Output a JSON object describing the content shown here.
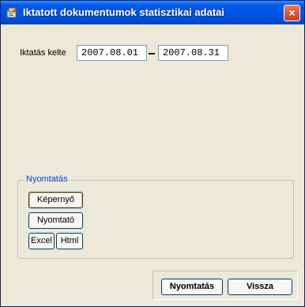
{
  "window": {
    "title": "Iktatott dokumentumok statisztikai adatai",
    "close_symbol": "×"
  },
  "date_filter": {
    "label": "Iktatás kelte",
    "from": "2007.08.01",
    "to": "2007.08.31"
  },
  "print_group": {
    "title": "Nyomtatás",
    "buttons": {
      "screen": "Képernyő",
      "printer": "Nyomtató",
      "excel": "Excel",
      "html": "Html"
    }
  },
  "footer": {
    "print_label": "Nyomtatás",
    "back_label": "Vissza"
  },
  "icons": {
    "app": "app-icon",
    "close": "close-icon"
  }
}
